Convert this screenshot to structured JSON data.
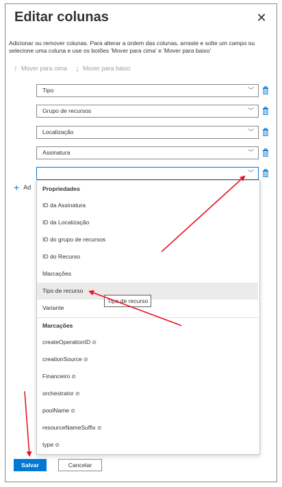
{
  "dialog": {
    "title": "Editar colunas",
    "close_icon": "✕",
    "description": "Adicionar ou remover colunas. Para alterar a ordem das colunas, arraste e solte um campo ou selecione uma coluna e use os botões 'Mover para cima' e 'Mover para baixo'",
    "move_up_label": "Mover para cima",
    "move_down_label": "Mover para baixo"
  },
  "columns": [
    {
      "value": "Tipo"
    },
    {
      "value": "Grupo de recursos"
    },
    {
      "value": "Localização"
    },
    {
      "value": "Assinatura"
    },
    {
      "value": ""
    }
  ],
  "add_label": "Ad",
  "dropdown": {
    "group1_header": "Propriedades",
    "group1_items": [
      "ID da Assinatura",
      "ID da Localização",
      "ID do grupo de recursos",
      "ID do Recurso",
      "Marcações",
      "Tipo de recurso",
      "Variante"
    ],
    "group2_header": "Marcações",
    "group2_items": [
      "createOperationID",
      "creationSource",
      "Financeiro",
      "orchestrator",
      "poolName",
      "resourceNameSuffix",
      "type"
    ],
    "tag_icon_glyph": "⊘",
    "hovered_item": "Tipo de recurso"
  },
  "tooltip": "Tipo de recurso",
  "footer": {
    "save_label": "Salvar",
    "cancel_label": "Cancelar"
  },
  "colors": {
    "accent": "#0078d4",
    "annotation_arrow": "#e81123"
  }
}
